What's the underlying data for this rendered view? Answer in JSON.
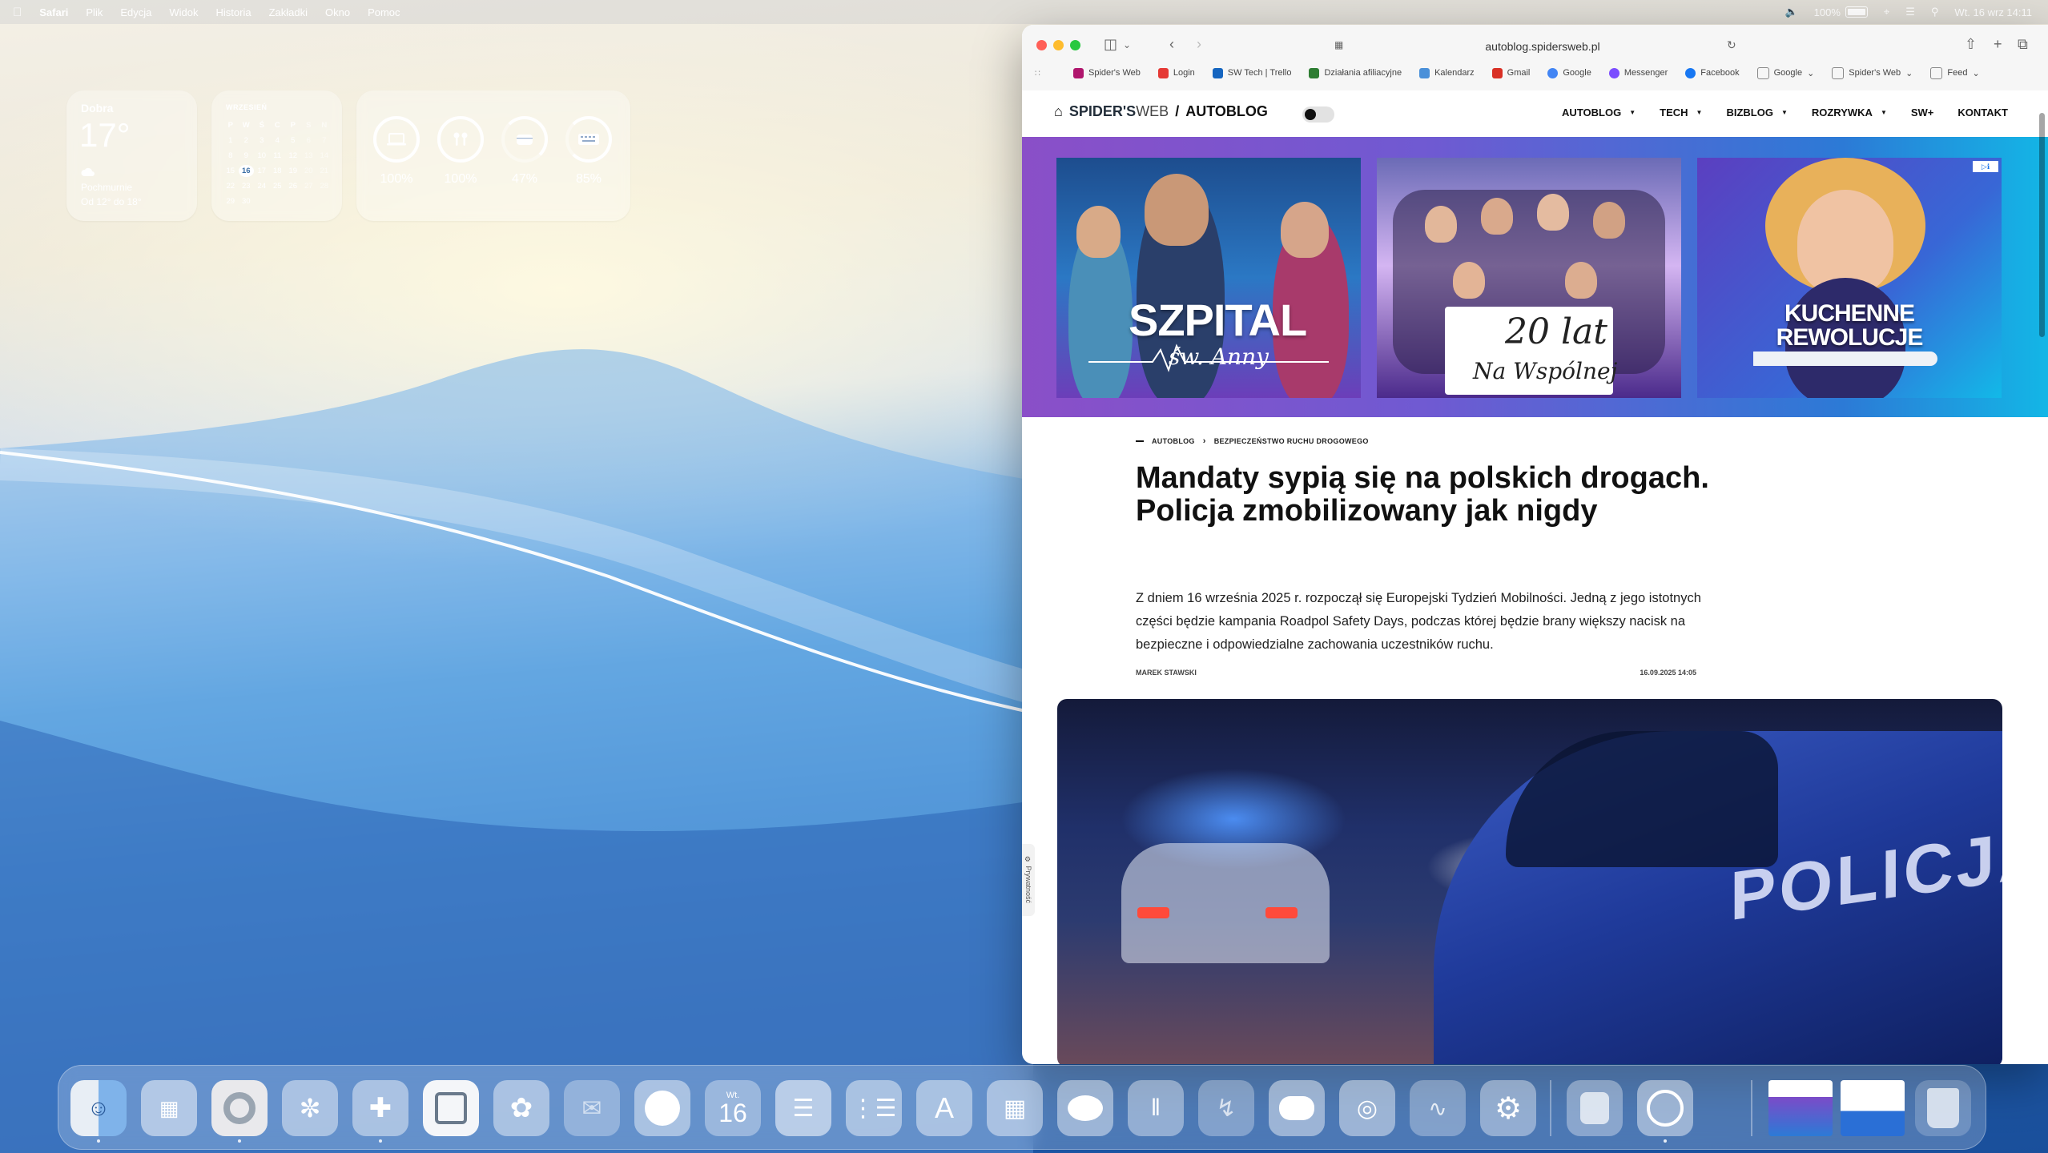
{
  "menubar": {
    "app": "Safari",
    "items": [
      "Plik",
      "Edycja",
      "Widok",
      "Historia",
      "Zakładki",
      "Okno",
      "Pomoc"
    ],
    "battery": "100%",
    "datetime": "Wt. 16 wrz  14:11"
  },
  "weather": {
    "city": "Dobra",
    "temp": "17°",
    "condition": "Pochmurnie",
    "range": "Od 12° do 18°"
  },
  "calendar": {
    "month": "WRZESIEŃ",
    "headers": [
      "P",
      "W",
      "Ś",
      "C",
      "P",
      "S",
      "N"
    ],
    "rows": [
      [
        "1",
        "2",
        "3",
        "4",
        "5",
        "6",
        "7"
      ],
      [
        "8",
        "9",
        "10",
        "11",
        "12",
        "13",
        "14"
      ],
      [
        "15",
        "16",
        "17",
        "18",
        "19",
        "20",
        "21"
      ],
      [
        "22",
        "23",
        "24",
        "25",
        "26",
        "27",
        "28"
      ],
      [
        "29",
        "30",
        "",
        "",
        "",
        "",
        ""
      ]
    ],
    "today": "16"
  },
  "batteries": [
    {
      "device": "laptop-icon",
      "pct": "100%"
    },
    {
      "device": "airpods-icon",
      "pct": "100%"
    },
    {
      "device": "case-icon",
      "pct": "47%"
    },
    {
      "device": "keyboard-icon",
      "pct": "85%"
    }
  ],
  "browser": {
    "url": "autoblog.spidersweb.pl",
    "favorites": [
      "Spider's Web",
      "Login",
      "SW Tech | Trello",
      "Działania afiliacyjne",
      "Kalendarz",
      "Gmail",
      "Google",
      "Messenger",
      "Facebook",
      "Google",
      "Spider's Web",
      "Feed"
    ],
    "fav_colors": [
      "#b0166d",
      "#e53935",
      "#1565c0",
      "#2e7d32",
      "#4a90d9",
      "#d93025",
      "#4285f4",
      "#7b4dff",
      "#1877f2",
      "#888888",
      "#888888",
      "#888888"
    ]
  },
  "site": {
    "logo_brand": "SPIDER'S",
    "logo_web": "WEB",
    "logo_section": "AUTOBLOG",
    "nav": [
      "AUTOBLOG",
      "TECH",
      "BIZBLOG",
      "ROZRYWKA",
      "SW+",
      "KONTAKT"
    ],
    "banner": {
      "tile1_title": "SZPITAL",
      "tile1_sub": "św. Anny",
      "tile2_title": "20 lat",
      "tile2_sub": "Na Wspólnej",
      "tile3_title": "KUCHENNE REWOLUCJE"
    }
  },
  "article": {
    "crumb1": "AUTOBLOG",
    "crumb2": "BEZPIECZEŃSTWO RUCHU DROGOWEGO",
    "title": "Mandaty sypią się na polskich drogach. Policja zmobilizowany jak nigdy",
    "lead": "Z dniem 16 września 2025 r. rozpoczął się Europejski Tydzień Mobilności. Jedną z jego istotnych części będzie kampania Roadpol Safety Days, podczas której będzie brany większy nacisk na bezpieczne i odpowiedzialne zachowania uczestników ruchu.",
    "author": "MAREK STAWSKI",
    "date": "16.09.2025 14:05",
    "hero_text": "POLICJA",
    "privacy": "Prywatność"
  },
  "dock": {
    "calendar_day_label": "Wt.",
    "calendar_day": "16",
    "apps": [
      "finder-icon",
      "launchpad-icon",
      "chrome-icon",
      "arc-icon",
      "slack-icon",
      "trello-icon",
      "photos-icon",
      "mail-icon",
      "spotify-icon",
      "calendar-icon",
      "notes-icon",
      "reminders-icon",
      "app-store-icon",
      "calculator-icon",
      "messages-icon",
      "airpods-icon",
      "messenger-icon",
      "discord-icon",
      "nvidia-icon",
      "activity-monitor-icon",
      "system-settings-icon",
      "disk-utility-icon",
      "safari-icon",
      "window-thumb-icon",
      "window-thumb-icon",
      "trash-icon"
    ]
  }
}
